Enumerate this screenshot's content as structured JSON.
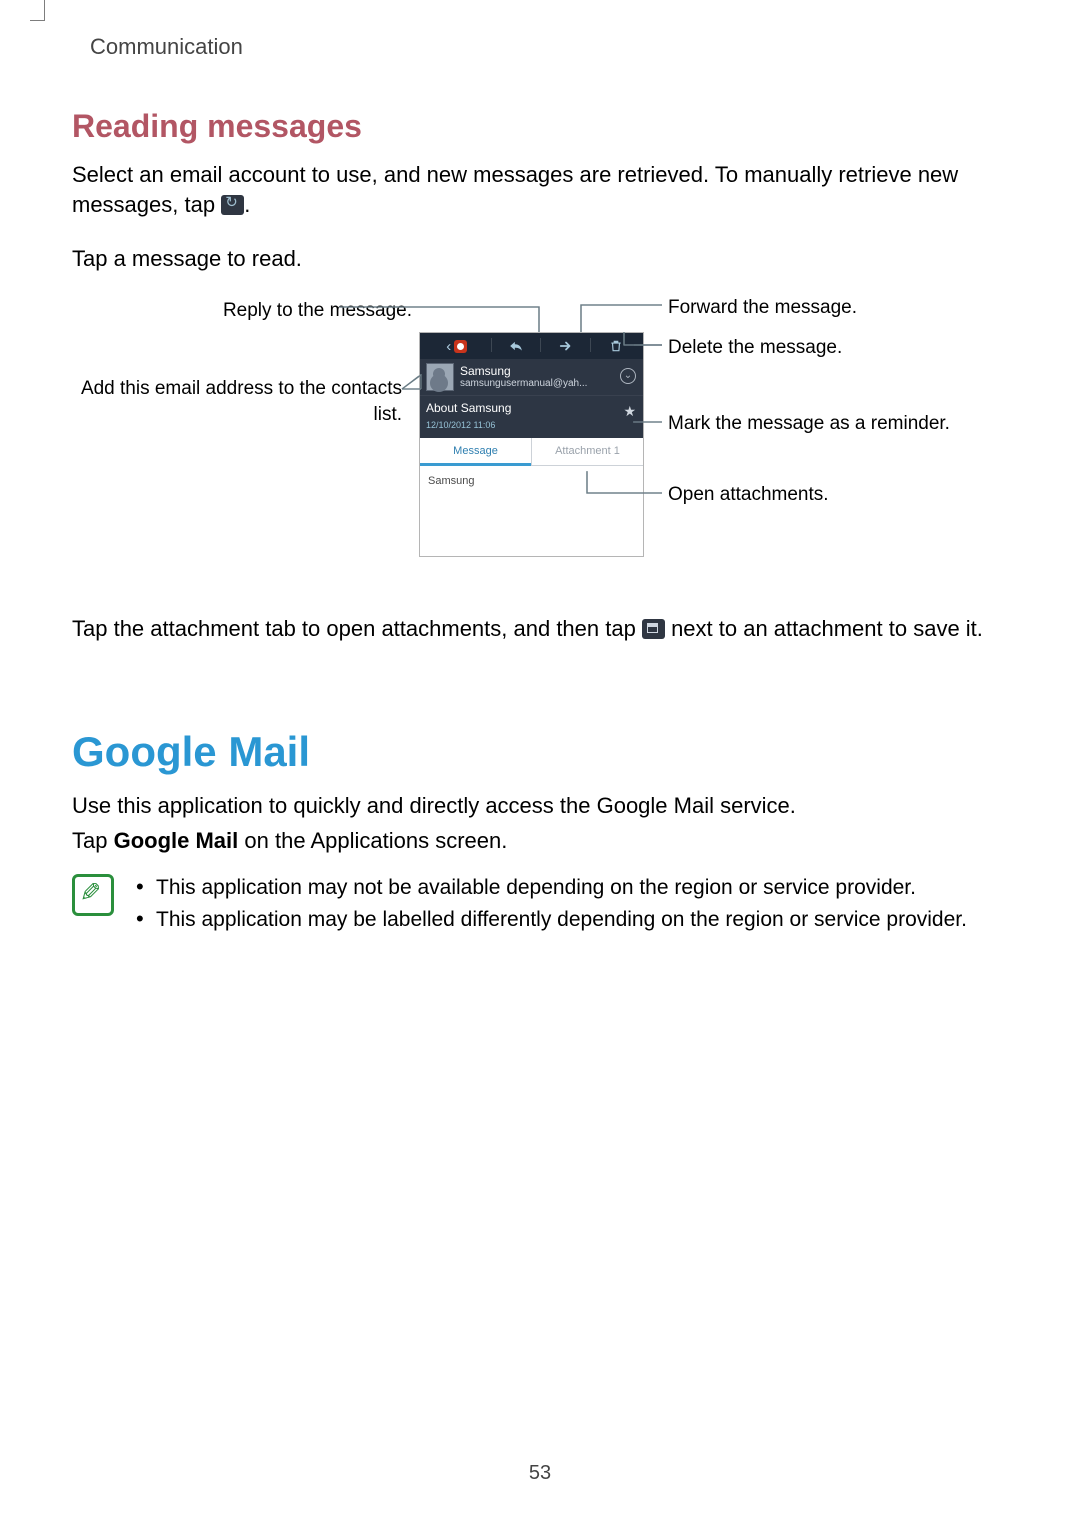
{
  "running_head": "Communication",
  "page_number": "53",
  "section_heading": "Reading messages",
  "para1_before": "Select an email account to use, and new messages are retrieved. To manually retrieve new messages, tap ",
  "para1_after": ".",
  "para2": "Tap a message to read.",
  "para3_before": "Tap the attachment tab to open attachments, and then tap ",
  "para3_after": " next to an attachment to save it.",
  "major_heading": "Google Mail",
  "gmail_p1": "Use this application to quickly and directly access the Google Mail service.",
  "gmail_p2_before": "Tap ",
  "gmail_p2_bold": "Google Mail",
  "gmail_p2_after": " on the Applications screen.",
  "note_items": [
    "This application may not be available depending on the region or service provider.",
    "This application may be labelled differently depending on the region or service provider."
  ],
  "callouts": {
    "reply": "Reply to the message.",
    "add_contact": "Add this email address to the contacts list.",
    "forward": "Forward the message.",
    "delete": "Delete the message.",
    "mark_reminder": "Mark the message as a reminder.",
    "open_attach": "Open attachments."
  },
  "phone": {
    "sender_name": "Samsung",
    "sender_email": "samsungusermanual@yah...",
    "subject": "About Samsung",
    "date": "12/10/2012  11:06",
    "tab_message": "Message",
    "tab_attach": "Attachment 1",
    "body_text": "Samsung"
  }
}
